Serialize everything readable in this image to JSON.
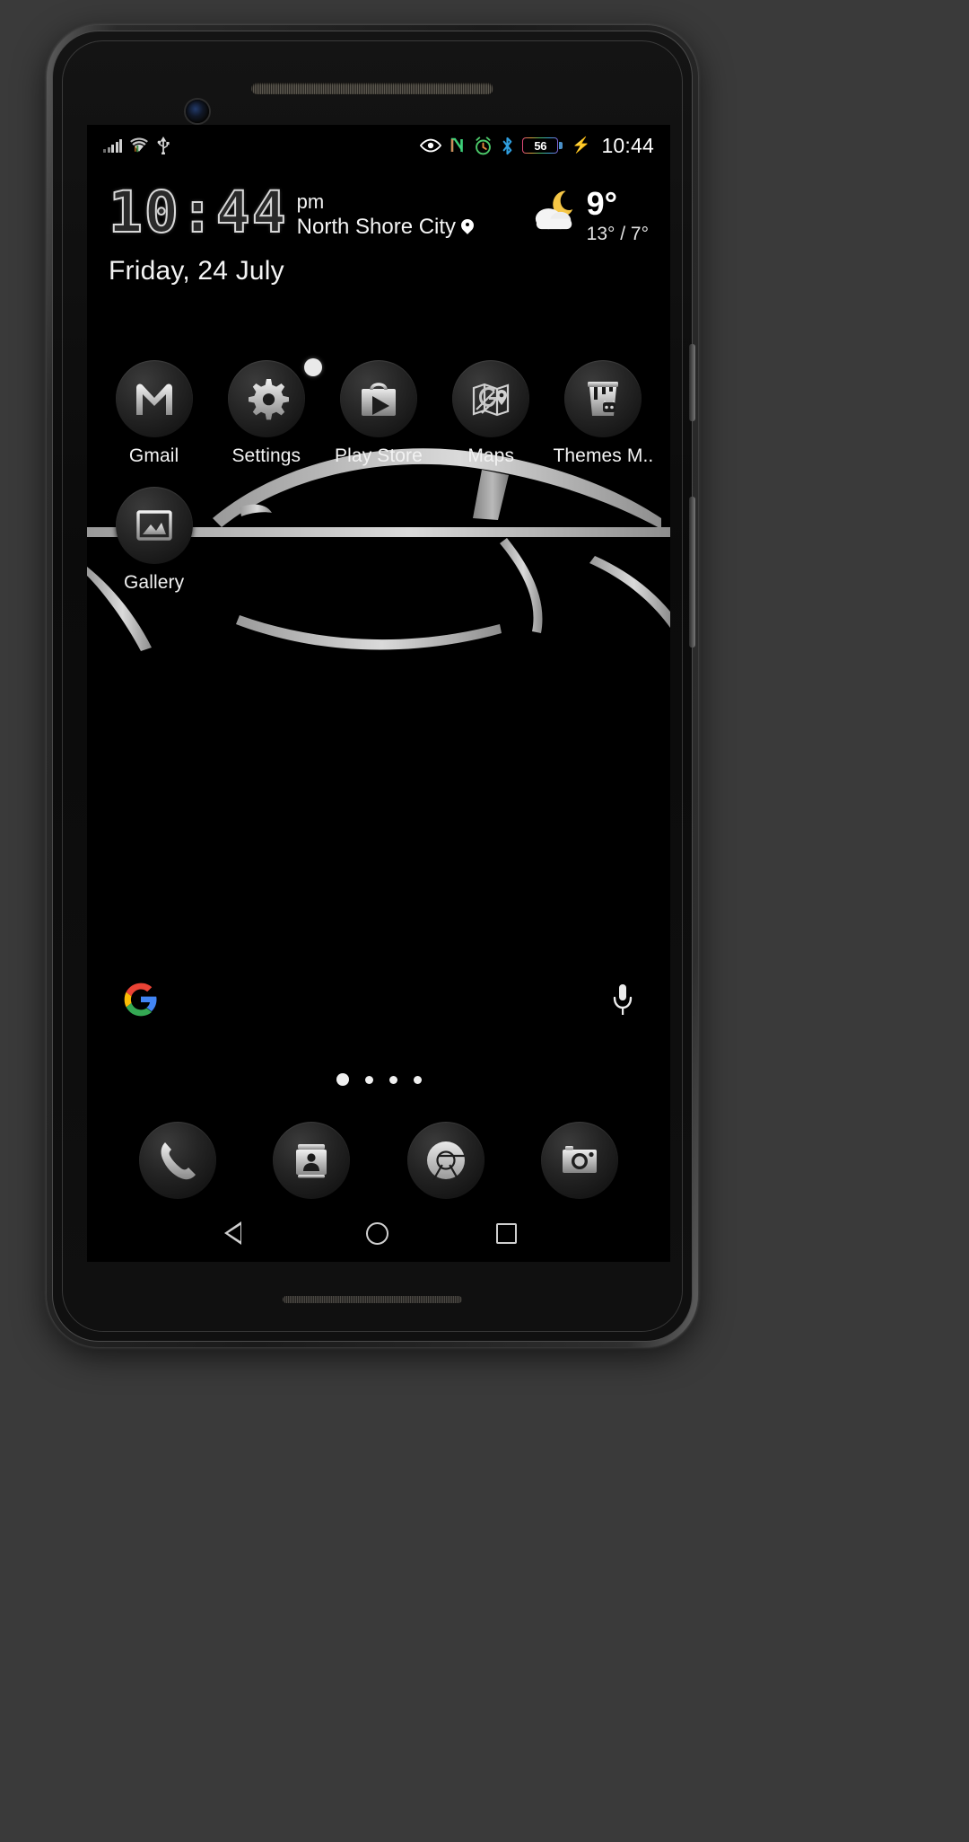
{
  "device": {
    "type": "android-phone"
  },
  "status_bar": {
    "left_icons": [
      "signal-bars-icon",
      "wifi-icon",
      "usb-icon"
    ],
    "right_icons": [
      "eye-icon",
      "nfc-icon",
      "alarm-icon",
      "bluetooth-icon"
    ],
    "battery_percent": "56",
    "charging": true,
    "time": "10:44",
    "colors": {
      "nfc": "#3dd17a",
      "alarm": "#4cc96a",
      "bluetooth": "#2f9fe0",
      "battery_text": "#ffffff"
    }
  },
  "widget": {
    "clock_time": "10:44",
    "am_pm": "pm",
    "location": "North Shore City",
    "location_icon": "location-pin-icon",
    "date": "Friday, 24 July",
    "weather": {
      "icon": "partly-cloudy-night-icon",
      "current_temp": "9°",
      "high_low": "13° / 7°",
      "moon_color": "#f5c646",
      "cloud_color": "#f2f2f2"
    }
  },
  "app_grid": {
    "apps": [
      {
        "label": "Gmail",
        "icon": "gmail-icon",
        "badge": false
      },
      {
        "label": "Settings",
        "icon": "settings-gear-icon",
        "badge": true
      },
      {
        "label": "Play Store",
        "icon": "play-store-icon",
        "badge": false
      },
      {
        "label": "Maps",
        "icon": "maps-icon",
        "badge": false
      },
      {
        "label": "Themes M..",
        "icon": "paint-bucket-icon",
        "badge": false
      },
      {
        "label": "Gallery",
        "icon": "gallery-icon",
        "badge": false
      }
    ]
  },
  "search_row": {
    "google_logo": "google-g-icon",
    "mic": "microphone-icon"
  },
  "page_indicator": {
    "count": 4,
    "active_index": 0
  },
  "dock": {
    "items": [
      {
        "name": "Phone",
        "icon": "phone-icon"
      },
      {
        "name": "Contacts",
        "icon": "contacts-icon"
      },
      {
        "name": "Chrome",
        "icon": "chrome-icon"
      },
      {
        "name": "Camera",
        "icon": "camera-icon"
      }
    ]
  },
  "nav_bar": {
    "back": "back-triangle-icon",
    "home": "home-circle-icon",
    "recents": "recents-square-icon"
  },
  "wallpaper": {
    "subject": "sports-car-silhouette",
    "background": "#000000"
  }
}
